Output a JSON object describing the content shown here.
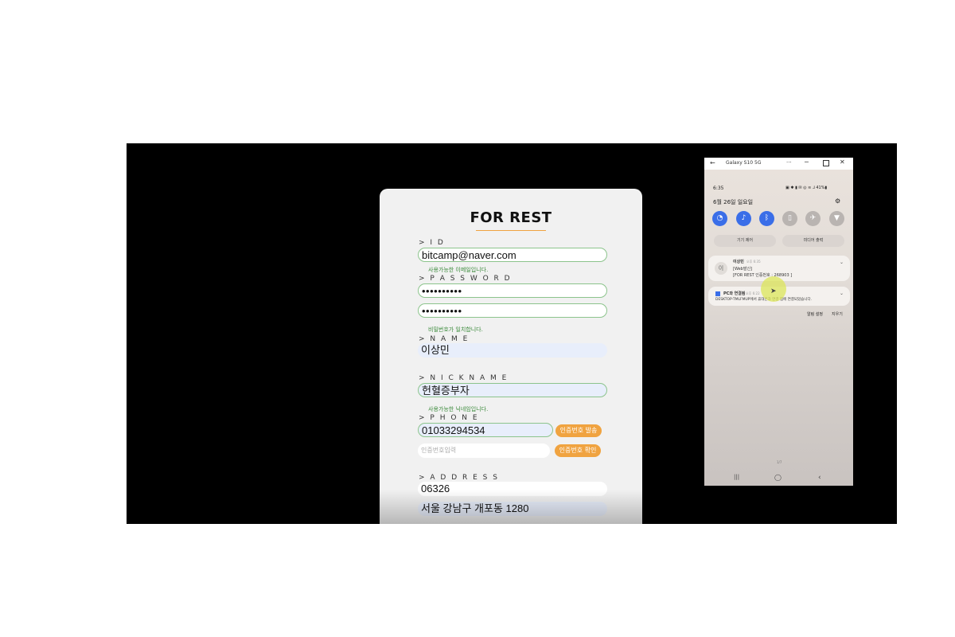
{
  "form": {
    "title": "FOR REST",
    "id": {
      "label": "> I D",
      "value": "bitcamp@naver.com",
      "hint": "사용가능한 이메일입니다."
    },
    "password": {
      "label": "> P A S S W O R D",
      "value": "••••••••••",
      "confirm_value": "••••••••••",
      "hint": "비밀번호가 일치합니다."
    },
    "name": {
      "label": "> N A M E",
      "value": "이상민"
    },
    "nickname": {
      "label": "> N I C K N A M E",
      "value": "헌혈증부자",
      "hint": "사용가능한 닉네임입니다."
    },
    "phone": {
      "label": "> P H O N E",
      "value": "01033294534",
      "send_button": "인증번호 발송",
      "code_placeholder": "인증번호입력",
      "confirm_button": "인증번호 확인"
    },
    "address": {
      "label": "> A D D R E S S",
      "zipcode": "06326",
      "address1": "서울 강남구 개포동 1280"
    }
  },
  "phone_window": {
    "title": "Galaxy S10 5G",
    "more": "···",
    "minimize": "─",
    "close": "✕",
    "back": "←",
    "status_time": "6:35",
    "status_icons": "▣ ✱ ▮ ✉ ◎ ≋ ⅃ 41%▮",
    "date": "6월 26일 일요일",
    "quick_settings": [
      {
        "icon": "wifi-icon",
        "glyph": "◔",
        "on": true
      },
      {
        "icon": "mute-icon",
        "glyph": "♪",
        "on": true
      },
      {
        "icon": "bluetooth-icon",
        "glyph": "ᛒ",
        "on": true
      },
      {
        "icon": "rotation-icon",
        "glyph": "▯",
        "on": false
      },
      {
        "icon": "airplane-icon",
        "glyph": "✈",
        "on": false
      },
      {
        "icon": "flashlight-icon",
        "glyph": "▼",
        "on": false
      }
    ],
    "device_control": "기기 제어",
    "media_output": "미디어 출력",
    "notifications": [
      {
        "avatar": "이",
        "sender": "이상민",
        "time": "오후 6:35",
        "line1": "[Web발신]",
        "line2": "[FOR REST 인증번호 : 268903 ]"
      },
      {
        "sender": "PC와 연결됨",
        "time": "오후 6:22",
        "line1": "DESKTOP-TMLFMUP에서 휴대폰과 연결 앱에 연결되었습니다."
      }
    ],
    "notif_settings": "알림 설정",
    "clear": "지우기",
    "page_indicator": "1/7",
    "nav": {
      "recent": "|||",
      "home": "◯",
      "back": "‹"
    }
  }
}
